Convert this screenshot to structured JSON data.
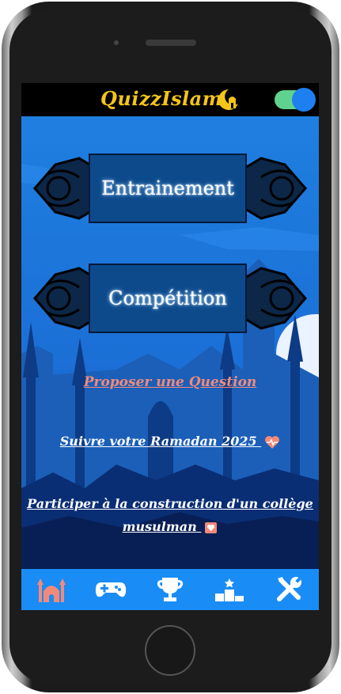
{
  "app": {
    "title": "QuizzIslam",
    "title_icon": "mosque-crescent-icon",
    "dark_mode_toggle": {
      "state": "on",
      "track_color": "#5fd38d",
      "knob_color": "#1e7ff0"
    }
  },
  "main": {
    "buttons": [
      {
        "label": "Entrainement"
      },
      {
        "label": "Compétition"
      }
    ],
    "links": {
      "propose": "Proposer une Question",
      "ramadan": "Suivre votre Ramadan 2025",
      "college_line1": "Participer à la construction d'un collège",
      "college_line2": "musulman"
    }
  },
  "bottom_nav": {
    "items": [
      {
        "icon": "mosque-icon",
        "active": true
      },
      {
        "icon": "gamepad-icon"
      },
      {
        "icon": "trophy-icon"
      },
      {
        "icon": "podium-icon"
      },
      {
        "icon": "tools-icon"
      }
    ]
  },
  "colors": {
    "accent": "#f5c518",
    "nav_bar": "#1a8cf5",
    "active_icon": "#f28a7a",
    "link_red": "#f28a7a"
  }
}
